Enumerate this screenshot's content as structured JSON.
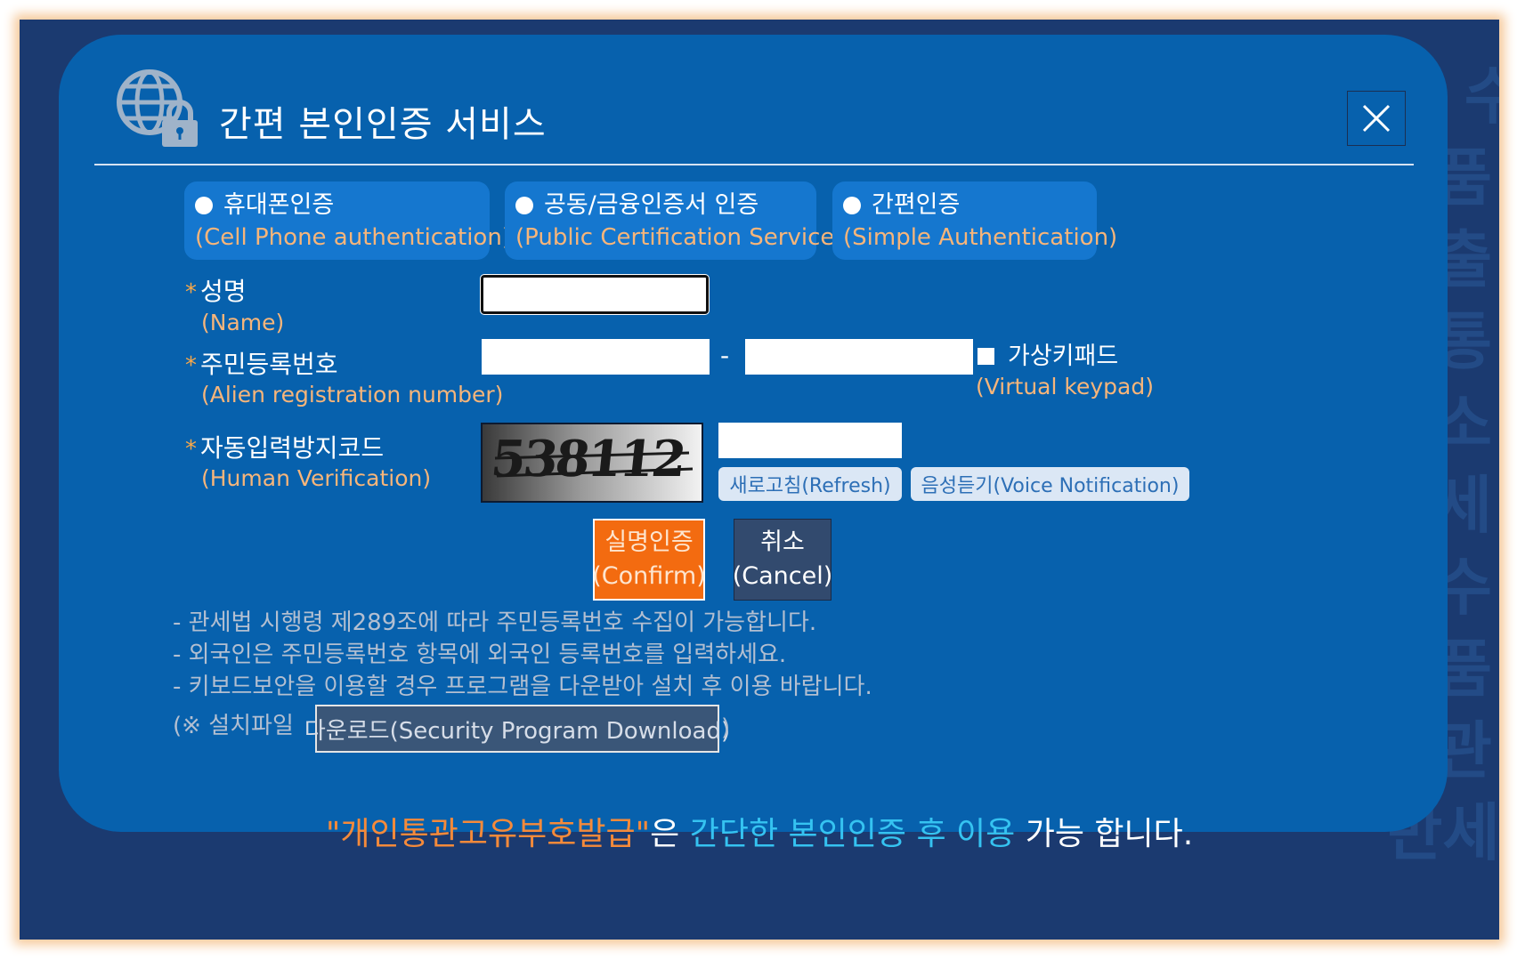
{
  "colors": {
    "frame_bg": "#1b3a70",
    "modal_bg": "#0761ad",
    "tab_bg": "#1577cf",
    "accent_orange": "#f7b57a",
    "confirm_bg": "#f36b10",
    "cancel_bg": "#324a6e",
    "cyan": "#35c3f1"
  },
  "background_text": [
    "민 수",
    "품",
    "출",
    "통",
    "소",
    "세",
    "수",
    "품",
    "관",
    "반세"
  ],
  "modal": {
    "title": "간편 본인인증 서비스",
    "logo_icon": "globe-lock-icon",
    "close_icon": "close-icon"
  },
  "tabs": [
    {
      "label": "휴대폰인증",
      "sub": "(Cell Phone authentication)"
    },
    {
      "label": "공동/금융인증서 인증",
      "sub": "(Public Certification Service)"
    },
    {
      "label": "간편인증",
      "sub": "(Simple Authentication)"
    }
  ],
  "form": {
    "name": {
      "star": "*",
      "label": "성명",
      "sub": "(Name)",
      "value": ""
    },
    "alien": {
      "star": "*",
      "label": "주민등록번호",
      "sub": "(Alien registration number)",
      "separator": "-",
      "value1": "",
      "value2": ""
    },
    "keypad": {
      "label": "가상키패드",
      "sub": "(Virtual keypad)"
    },
    "captcha": {
      "star": "*",
      "label": "자동입력방지코드",
      "sub": "(Human Verification)",
      "code": "538112",
      "value": "",
      "refresh": "새로고침(Refresh)",
      "voice": "음성듣기(Voice Notification)"
    }
  },
  "buttons": {
    "confirm": {
      "line1": "실명인증",
      "line2": "(Confirm)"
    },
    "cancel": {
      "line1": "취소",
      "line2": "(Cancel)"
    }
  },
  "notes": [
    "- 관세법 시행령 제289조에 따라 주민등록번호 수집이 가능합니다.",
    "- 외국인은 주민등록번호 항목에 외국인 등록번호를 입력하세요.",
    "- 키보드보안을 이용할 경우 프로그램을 다운받아 설치 후 이용 바랍니다."
  ],
  "install": {
    "prefix": "(※ 설치파일",
    "download": "다운로드(Security Program Download)",
    "suffix": ")"
  },
  "footer": {
    "part1": "\"개인통관고유부호발급\"",
    "part2": "은 ",
    "part3": "간단한 본인인증 후 이용",
    "part4": " 가능 합니다."
  }
}
